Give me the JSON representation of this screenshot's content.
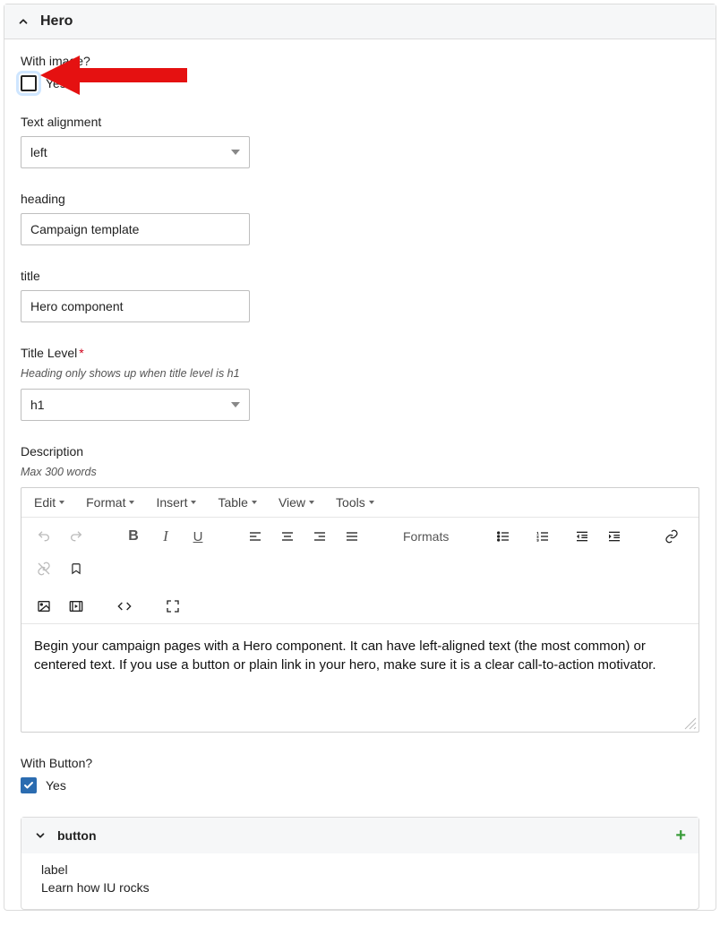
{
  "panel": {
    "title": "Hero"
  },
  "with_image": {
    "label": "With image?",
    "checkbox_label": "Yes",
    "checked": false
  },
  "text_alignment": {
    "label": "Text alignment",
    "value": "left"
  },
  "heading": {
    "label": "heading",
    "value": "Campaign template"
  },
  "title": {
    "label": "title",
    "value": "Hero component"
  },
  "title_level": {
    "label": "Title Level",
    "required_marker": "*",
    "hint": "Heading only shows up when title level is h1",
    "value": "h1"
  },
  "description": {
    "label": "Description",
    "hint": "Max 300 words",
    "menubar": {
      "edit": "Edit",
      "format": "Format",
      "insert": "Insert",
      "table": "Table",
      "view": "View",
      "tools": "Tools"
    },
    "formats_btn": "Formats",
    "content": "Begin your campaign pages with a Hero component. It can have left-aligned text (the most common) or centered text. If you use a button or plain link in your hero, make sure it is a clear call-to-action motivator."
  },
  "with_button": {
    "label": "With Button?",
    "checkbox_label": "Yes",
    "checked": true
  },
  "button_section": {
    "title": "button",
    "label_field_label": "label",
    "label_field_value": "Learn how IU rocks"
  },
  "annotation": {
    "arrow_color": "#e51111"
  }
}
